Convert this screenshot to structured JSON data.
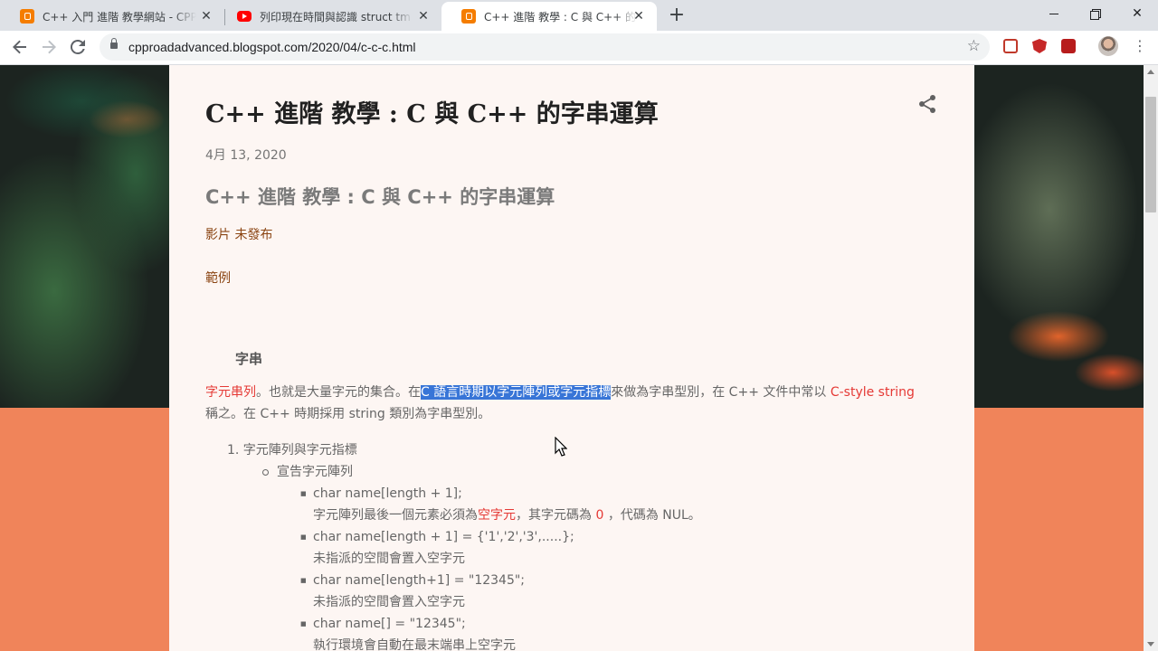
{
  "browser": {
    "tabs": [
      {
        "title": "C++ 入門 進階 教學網站 - CPP R",
        "favicon": "blogger-icon",
        "active": false
      },
      {
        "title": "列印現在時間與認識 struct tm -",
        "favicon": "youtube-icon",
        "active": false
      },
      {
        "title": "C++ 進階 教學 : C 與 C++ 的字串",
        "favicon": "blogger-icon",
        "active": true
      }
    ],
    "new_tab_symbol": "+",
    "close_symbol": "✕",
    "url": "cpproadadvanced.blogspot.com/2020/04/c-c-c.html",
    "window_close_symbol": "✕"
  },
  "post": {
    "title": "C++ 進階 教學 : C 與 C++ 的字串運算",
    "date": "4月 13, 2020",
    "subtitle": "C++ 進階 教學 : C 與 C++ 的字串運算",
    "video_link": "影片 未發布",
    "example_link": "範例",
    "section_heading": "字串",
    "paragraph": {
      "term": "字元串列",
      "text1": "。也就是大量字元的集合。在",
      "selected": "C 語言時期以字元陣列或字元指標",
      "text2": "來做為字串型別，在 C++ 文件中常以 ",
      "c_style": "C-style string",
      "text3": " 稱之。在 C++ 時期採用 string 類別為字串型別。"
    },
    "list": {
      "item1": "1. 字元陣列與字元指標",
      "sub1": "宣告字元陣列",
      "bullets": [
        {
          "code": "char name[length + 1];",
          "note_a": "字元陣列最後一個元素必須為",
          "note_red": "空字元",
          "note_b": "，其字元碼為 ",
          "note_zero": "0",
          "note_c": " ，代碼為 NUL。"
        },
        {
          "code": "char name[length + 1] = {'1','2','3',.....};",
          "note": "未指派的空間會置入空字元"
        },
        {
          "code": "char name[length+1] = \"12345\";",
          "note": "未指派的空間會置入空字元"
        },
        {
          "code": "char name[] = \"12345\";",
          "note": "執行環境會自動在最末端串上空字元"
        }
      ]
    }
  },
  "colors": {
    "tab_strip": "#dee1e6",
    "card": "#fdf6f3",
    "orange_band": "#f0845a",
    "link": "#8b4513",
    "highlight_red": "#e53935",
    "selection": "#3875d7"
  }
}
